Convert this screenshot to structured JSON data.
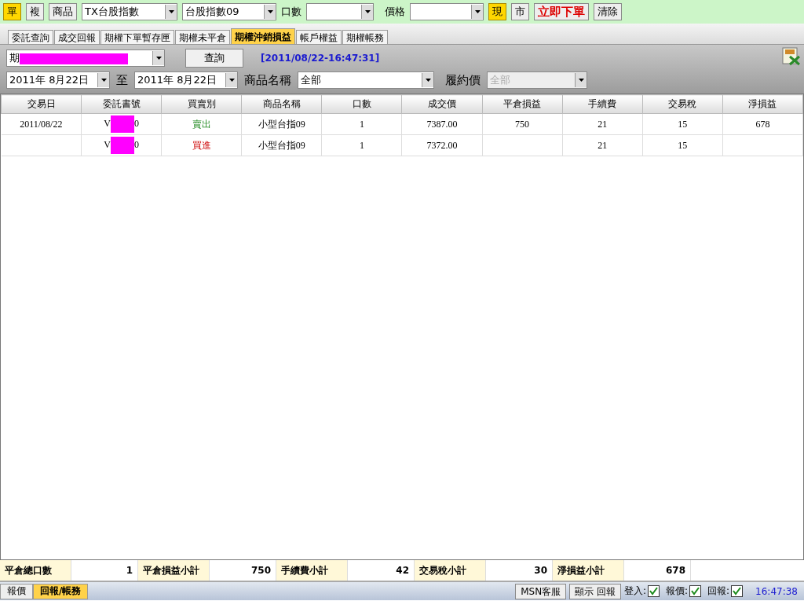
{
  "order_bar": {
    "buttons": [
      {
        "label": "單",
        "selected": true
      },
      {
        "label": "複",
        "selected": false
      }
    ],
    "product_button": "商品",
    "product_select": "TX台股指數",
    "contract_select": "台股指數09",
    "qty_label": "口數",
    "price_label": "價格",
    "price_type_buttons": [
      {
        "label": "現",
        "selected": true
      },
      {
        "label": "市",
        "selected": false
      }
    ],
    "submit_button": "立即下單",
    "clear_button": "清除"
  },
  "tabs": [
    {
      "label": "委託查詢",
      "selected": false
    },
    {
      "label": "成交回報",
      "selected": false
    },
    {
      "label": "期權下單暫存匣",
      "selected": false
    },
    {
      "label": "期權未平倉",
      "selected": false
    },
    {
      "label": "期權沖銷損益",
      "selected": true
    },
    {
      "label": "帳戶權益",
      "selected": false
    },
    {
      "label": "期權帳務",
      "selected": false
    }
  ],
  "query": {
    "account_prefix": "期",
    "query_button": "查詢",
    "timestamp": "[2011/08/22-16:47:31]",
    "date_from": "2011年  8月22日",
    "to_label": "至",
    "date_to": "2011年  8月22日",
    "product_label": "商品名稱",
    "product_value": "全部",
    "strike_label": "履約價",
    "strike_value": "全部",
    "strike_disabled": true
  },
  "table": {
    "columns": [
      "交易日",
      "委託書號",
      "買賣別",
      "商品名稱",
      "口數",
      "成交價",
      "平倉損益",
      "手續費",
      "交易稅",
      "淨損益"
    ],
    "rows": [
      {
        "date": "2011/08/22",
        "order_start": "V",
        "order_end": "0",
        "side": "賣出",
        "kind": "sell",
        "product": "小型台指09",
        "qty": "1",
        "price": "7387.00",
        "pnl": "750",
        "fee": "21",
        "tax": "15",
        "net": "678"
      },
      {
        "date": "",
        "order_start": "V",
        "order_end": "0",
        "side": "買進",
        "kind": "buy",
        "product": "小型台指09",
        "qty": "1",
        "price": "7372.00",
        "pnl": "",
        "fee": "21",
        "tax": "15",
        "net": ""
      }
    ]
  },
  "summary": [
    {
      "label": "平倉總口數",
      "value": "1"
    },
    {
      "label": "平倉損益小計",
      "value": "750"
    },
    {
      "label": "手續費小計",
      "value": "42"
    },
    {
      "label": "交易稅小計",
      "value": "30"
    },
    {
      "label": "淨損益小計",
      "value": "678"
    }
  ],
  "bottom_tabs": [
    {
      "label": "報價",
      "selected": false
    },
    {
      "label": "回報/帳務",
      "selected": true
    }
  ],
  "status": {
    "buttons": [
      "MSN客服",
      "顯示 回報"
    ],
    "checks": [
      {
        "label": "登入:",
        "checked": true
      },
      {
        "label": "報價:",
        "checked": true
      },
      {
        "label": "回報:",
        "checked": true
      }
    ],
    "time": "16:47:38"
  }
}
